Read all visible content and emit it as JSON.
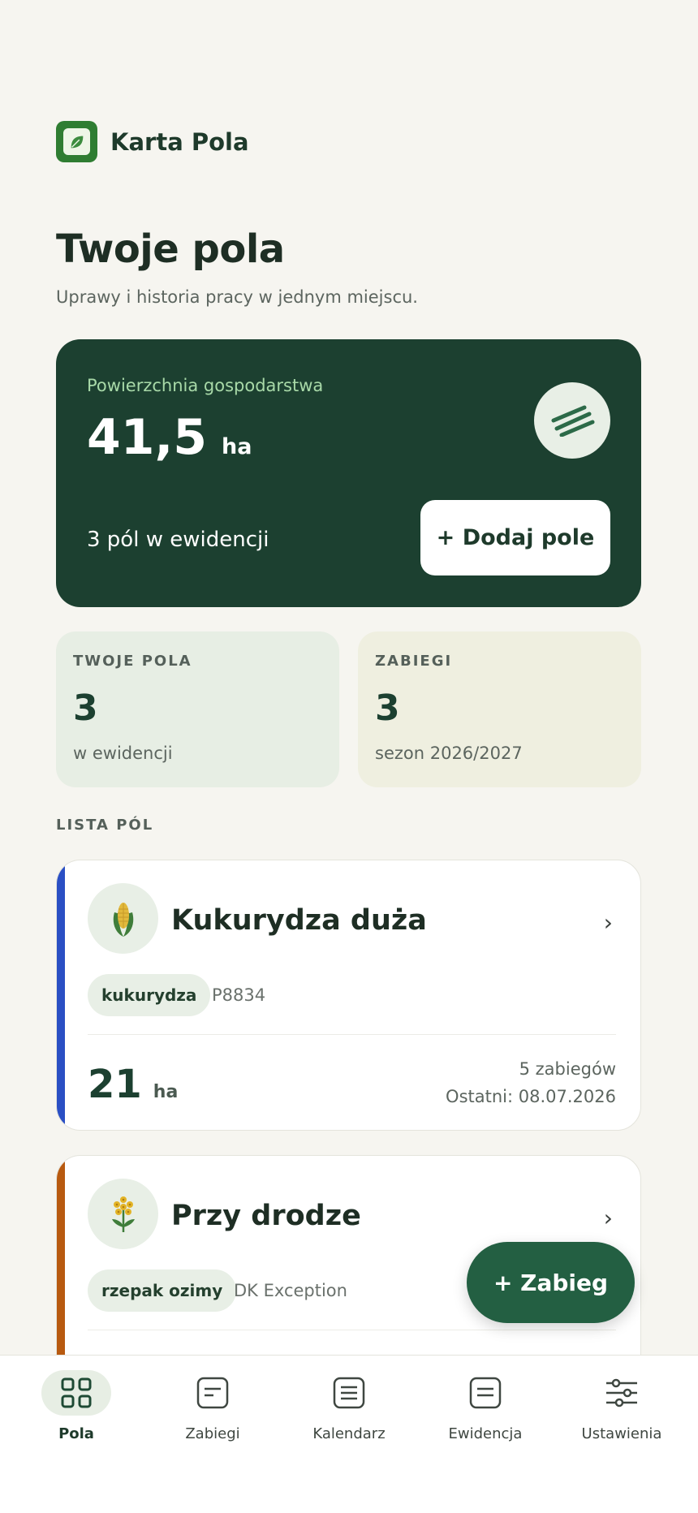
{
  "app": {
    "title": "Karta Pola",
    "logo_icon": "leaf-icon",
    "brand_color": "#2f7d32"
  },
  "page": {
    "title": "Twoje pola",
    "subtitle": "Uprawy i historia pracy w jednym miejscu."
  },
  "hero": {
    "label": "Powierzchnia gospodarstwa",
    "value": "41,5",
    "unit": "ha",
    "icon": "field-lines-icon",
    "count_text": "3 pól w ewidencji",
    "add_button": "+ Dodaj pole",
    "background": "#1c4030"
  },
  "stats": [
    {
      "label": "TWOJE POLA",
      "value": "3",
      "sub": "w ewidencji"
    },
    {
      "label": "ZABIEGI",
      "value": "3",
      "sub": "sezon 2026/2027"
    }
  ],
  "list": {
    "label": "LISTA PÓL",
    "fields": [
      {
        "name": "Kukurydza duża",
        "crop": "kukurydza",
        "variety": "P8834",
        "area": "21",
        "unit": "ha",
        "ops": "5 zabiegów",
        "last": "Ostatni: 08.07.2026",
        "icon": "corn-icon",
        "accent": "#2a4fc4"
      },
      {
        "name": "Przy drodze",
        "crop": "rzepak ozimy",
        "variety": "DK Exception",
        "icon": "rapeseed-icon",
        "accent": "#b85a10"
      }
    ]
  },
  "fab": {
    "label": "+ Zabieg"
  },
  "nav": [
    {
      "label": "Pola",
      "icon": "grid-icon",
      "active": true
    },
    {
      "label": "Zabiegi",
      "icon": "treatment-icon"
    },
    {
      "label": "Kalendarz",
      "icon": "calendar-list-icon"
    },
    {
      "label": "Ewidencja",
      "icon": "register-icon"
    },
    {
      "label": "Ustawienia",
      "icon": "sliders-icon"
    }
  ]
}
